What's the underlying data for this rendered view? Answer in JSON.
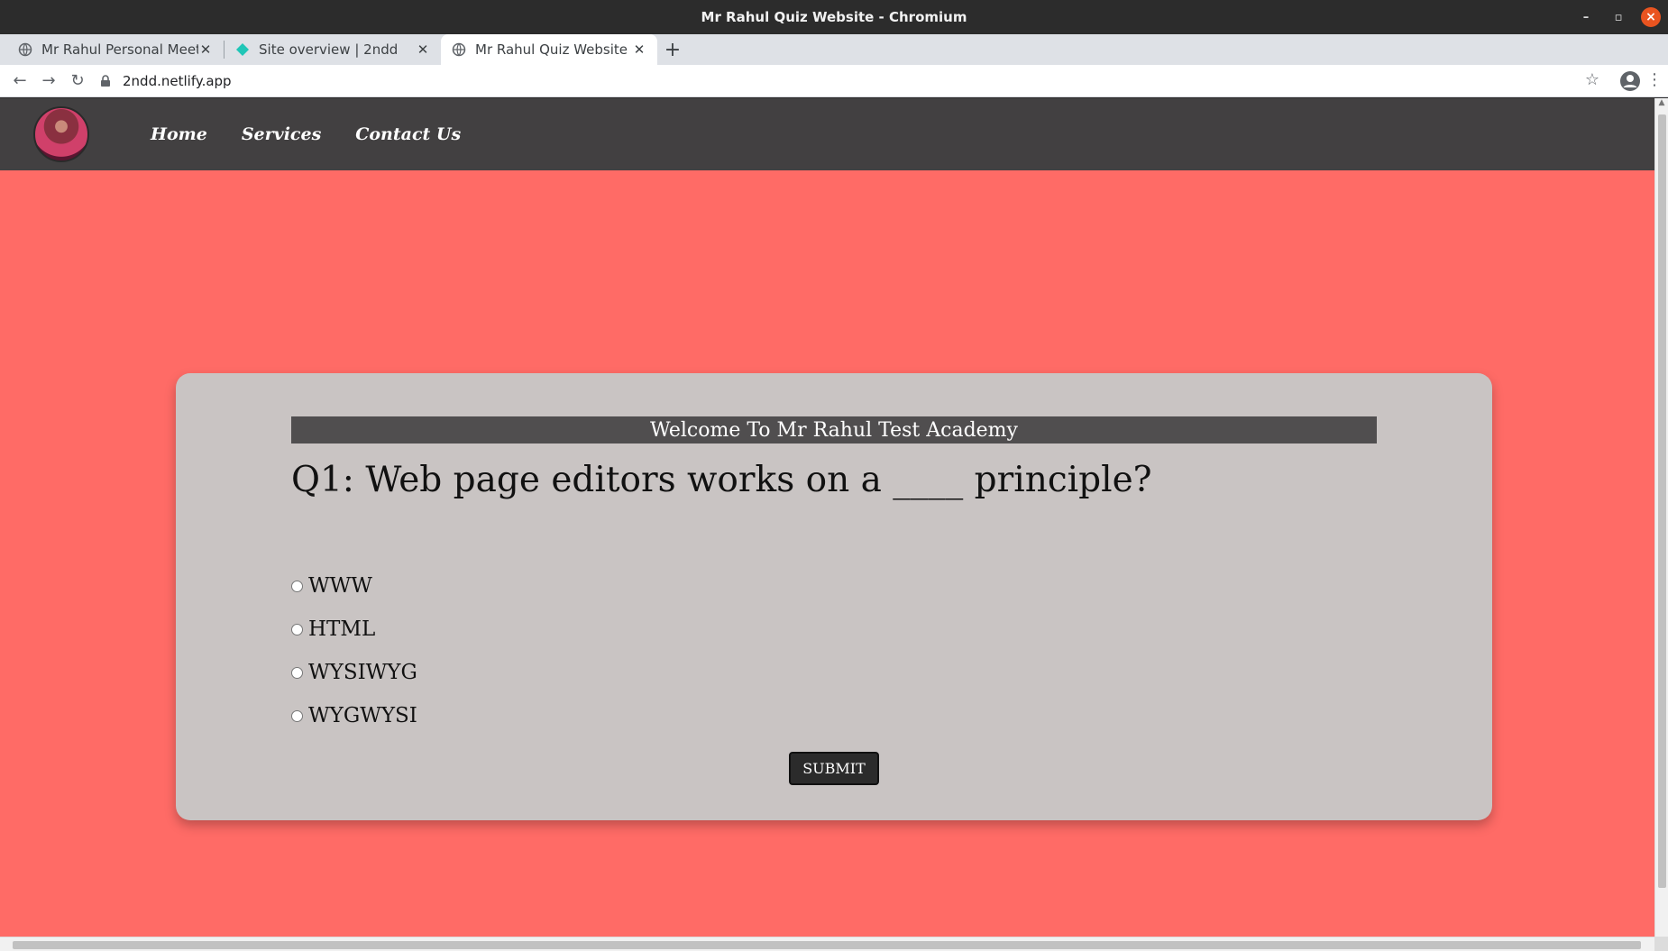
{
  "window": {
    "title": "Mr Rahul Quiz Website - Chromium",
    "accent_close": "#e95420"
  },
  "tabs": [
    {
      "title": "Mr Rahul Personal Meet",
      "icon": "globe-icon",
      "active": false
    },
    {
      "title": "Site overview | 2ndd",
      "icon": "netlify-icon",
      "active": false
    },
    {
      "title": "Mr Rahul Quiz Website",
      "icon": "globe-icon",
      "active": true
    }
  ],
  "addressbar": {
    "url": "2ndd.netlify.app"
  },
  "site": {
    "nav": {
      "items": [
        "Home",
        "Services",
        "Contact Us"
      ]
    },
    "colors": {
      "page_bg": "#ff6b66",
      "navbar_bg": "#424041",
      "card_bg": "#c9c4c3",
      "header_bg": "#504e4f"
    },
    "quiz": {
      "header": "Welcome To Mr Rahul Test Academy",
      "question": "Q1: Web page editors works on a ____ principle?",
      "options": [
        "WWW",
        "HTML",
        "WYSIWYG",
        "WYGWYSI"
      ],
      "submit_label": "SUBMIT"
    }
  }
}
